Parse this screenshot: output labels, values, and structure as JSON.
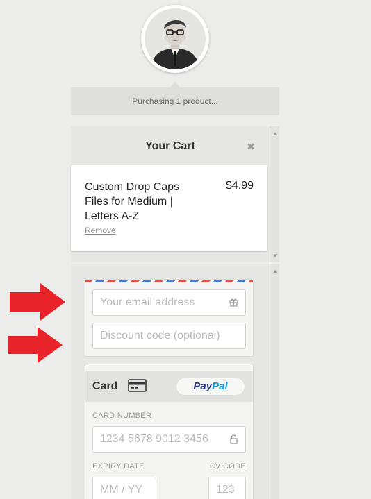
{
  "status": {
    "text": "Purchasing 1 product..."
  },
  "cart": {
    "title": "Your Cart",
    "items": [
      {
        "name": "Custom Drop Caps Files for Medium | Letters A-Z",
        "price": "$4.99",
        "remove_label": "Remove"
      }
    ]
  },
  "checkout": {
    "email_placeholder": "Your email address",
    "discount_placeholder": "Discount code (optional)",
    "payment_tab": "Card",
    "paypal_logo_text": [
      "Pay",
      "Pal"
    ],
    "card_number_label": "CARD NUMBER",
    "card_number_placeholder": "1234 5678 9012 3456",
    "expiry_label": "EXPIRY DATE",
    "expiry_placeholder": "MM / YY",
    "cvc_label": "CV CODE",
    "cvc_placeholder": "123"
  },
  "icons": {
    "close": "close-icon",
    "gift": "gift-icon",
    "card": "credit-card-icon",
    "lock": "lock-icon",
    "annotation_arrow": "red-arrow-icon"
  },
  "colors": {
    "background": "#ececea",
    "paypal_blue_dark": "#253b80",
    "paypal_blue_light": "#179bd7",
    "annotation_red": "#e8232a"
  }
}
